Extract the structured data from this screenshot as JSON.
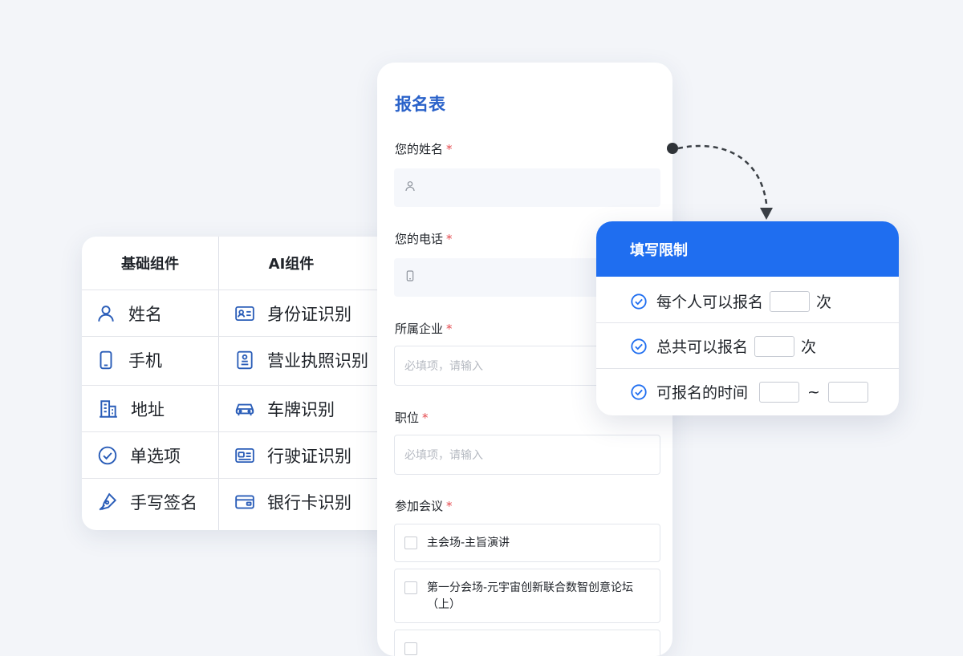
{
  "components": {
    "basic_header": "基础组件",
    "ai_header": "AI组件",
    "basic_items": [
      {
        "label": "姓名",
        "icon": "user-icon"
      },
      {
        "label": "手机",
        "icon": "phone-icon"
      },
      {
        "label": "地址",
        "icon": "building-icon"
      },
      {
        "label": "单选项",
        "icon": "check-circle-icon"
      },
      {
        "label": "手写签名",
        "icon": "pen-icon"
      }
    ],
    "ai_items": [
      {
        "label": "身份证识别",
        "icon": "id-card-icon"
      },
      {
        "label": "营业执照识别",
        "icon": "license-icon"
      },
      {
        "label": "车牌识别",
        "icon": "car-icon"
      },
      {
        "label": "行驶证识别",
        "icon": "driving-license-icon"
      },
      {
        "label": "银行卡识别",
        "icon": "bank-card-icon"
      }
    ]
  },
  "form": {
    "title": "报名表",
    "required_mark": "*",
    "fields": [
      {
        "label": "您的姓名",
        "type": "name",
        "placeholder": ""
      },
      {
        "label": "您的电话",
        "type": "phone",
        "placeholder": ""
      },
      {
        "label": "所属企业",
        "type": "text",
        "placeholder": "必填项，请输入"
      },
      {
        "label": "职位",
        "type": "text",
        "placeholder": "必填项，请输入"
      }
    ],
    "meeting_label": "参加会议",
    "meeting_options": [
      "主会场-主旨演讲",
      "第一分会场-元宇宙创新联合数智创意论坛（上）"
    ]
  },
  "limits": {
    "title": "填写限制",
    "rows": [
      {
        "label": "每个人可以报名",
        "suffix": "次"
      },
      {
        "label": "总共可以报名",
        "suffix": "次"
      },
      {
        "label": "可报名的时间",
        "separator": "~"
      }
    ]
  },
  "colors": {
    "accent": "#1f6ef0",
    "title_blue": "#2a62c9",
    "icon_blue": "#2a5db8",
    "required_red": "#e5484d"
  }
}
